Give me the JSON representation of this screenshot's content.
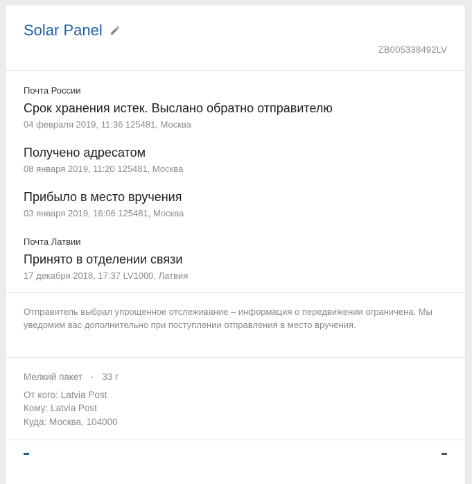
{
  "header": {
    "title": "Solar Panel",
    "tracking_number": "ZB005338492LV"
  },
  "events": [
    {
      "carrier": "Почта России",
      "status": "Срок хранения истек. Выслано обратно отправителю",
      "meta": "04 февраля 2019, 11:36 125481, Москва"
    },
    {
      "carrier": "",
      "status": "Получено адресатом",
      "meta": "08 января 2019, 11:20 125481, Москва"
    },
    {
      "carrier": "",
      "status": "Прибыло в место вручения",
      "meta": "03 января 2019, 16:06 125481, Москва"
    },
    {
      "carrier": "Почта Латвии",
      "status": "Принято в отделении связи",
      "meta": "17 декабря 2018, 17:37 LV1000, Латвия"
    }
  ],
  "notice": "Отправитель выбрал упрощенное отслеживание – информация о передвижении ограничена. Мы уведомим вас дополнительно при поступлении отправления в место вручения.",
  "details": {
    "package_type": "Мелкий пакет",
    "separator": "·",
    "weight": "33 г",
    "from": "От кого: Latvia Post",
    "to": "Кому: Latvia Post",
    "destination": "Куда: Москва, 104000"
  },
  "colors": {
    "accent": "#1f5fa8",
    "muted": "#8a8a8a",
    "text": "#222222"
  },
  "icons": {
    "edit": "pencil-icon"
  }
}
